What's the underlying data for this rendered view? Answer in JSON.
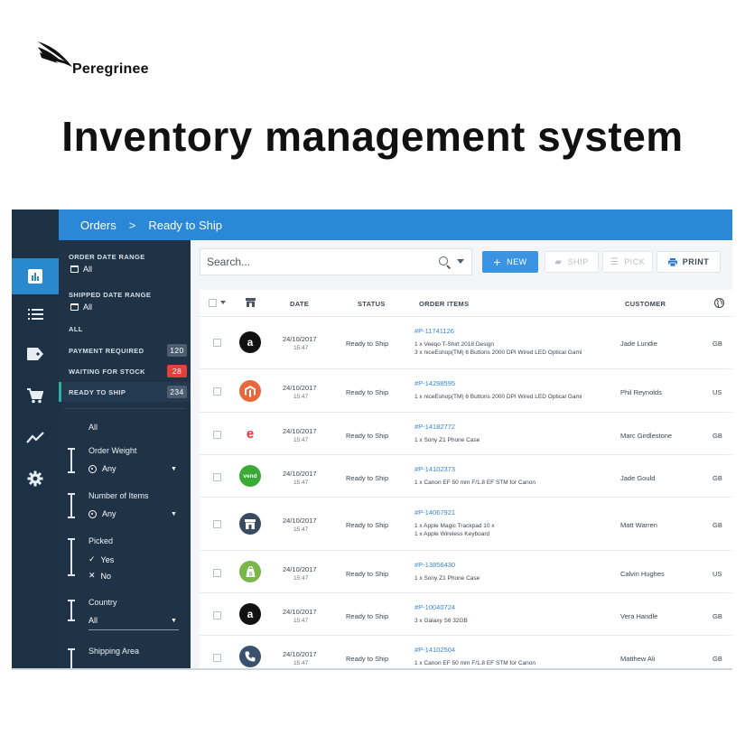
{
  "brand": {
    "name": "Peregrinee",
    "headline": "Inventory management system"
  },
  "colors": {
    "accent": "#2a88d6",
    "sidebar": "#1d3144",
    "filter_panel": "#1f3246",
    "badge_alert": "#e0423a",
    "link": "#3a87d2"
  },
  "nav_rail": {
    "items": [
      {
        "icon": "bar-chart-icon",
        "active": true
      },
      {
        "icon": "list-icon",
        "active": false
      },
      {
        "icon": "tag-icon",
        "active": false
      },
      {
        "icon": "cart-icon",
        "active": false
      },
      {
        "icon": "trend-line-icon",
        "active": false
      },
      {
        "icon": "gear-icon",
        "active": false
      }
    ]
  },
  "breadcrumb": {
    "root": "Orders",
    "separator": ">",
    "current": "Ready to Ship"
  },
  "filters": {
    "order_date_label": "ORDER DATE RANGE",
    "order_date_value": "All",
    "shipped_date_label": "SHIPPED DATE RANGE",
    "shipped_date_value": "All",
    "status_all": "ALL",
    "statuses": [
      {
        "label": "PAYMENT REQUIRED",
        "count": "120",
        "alert": false
      },
      {
        "label": "WAITING FOR STOCK",
        "count": "28",
        "alert": true
      },
      {
        "label": "READY TO SHIP",
        "count": "234",
        "alert": false,
        "selected": true
      }
    ],
    "all_label": "All",
    "order_weight": {
      "title": "Order Weight",
      "value": "Any"
    },
    "number_of_items": {
      "title": "Number of Items",
      "value": "Any"
    },
    "picked": {
      "title": "Picked",
      "yes": "Yes",
      "no": "No"
    },
    "country": {
      "title": "Country",
      "value": "All"
    },
    "shipping_area": {
      "title": "Shipping Area"
    }
  },
  "toolbar": {
    "search_placeholder": "Search...",
    "new_label": "NEW",
    "ship_label": "SHIP",
    "pick_label": "PICK",
    "print_label": "PRINT"
  },
  "table": {
    "headers": {
      "date": "DATE",
      "status": "STATUS",
      "order_items": "ORDER ITEMS",
      "customer": "CUSTOMER"
    },
    "rows": [
      {
        "store": "amazon",
        "store_icon": "amazon-icon",
        "date": "24/10/2017",
        "time": "15:47",
        "status": "Ready to Ship",
        "order_id": "#P-11741126",
        "items": [
          "1 x Veeqo T-Shirt 2018 Design",
          "3 x niceEshop(TM) 6 Buttons 2000 DPI Wired LED Optical Gami"
        ],
        "customer": "Jade Lundie",
        "country": "GB"
      },
      {
        "store": "magento",
        "store_icon": "magento-icon",
        "date": "24/10/2017",
        "time": "15:47",
        "status": "Ready to Ship",
        "order_id": "#P-14298595",
        "items": [
          "1 x niceEshop(TM) 6 Buttons 2000 DPI Wired LED Optical Gami"
        ],
        "customer": "Phil Reynolds",
        "country": "US"
      },
      {
        "store": "ebay",
        "store_icon": "ebay-icon",
        "date": "24/10/2017",
        "time": "15:47",
        "status": "Ready to Ship",
        "order_id": "#P-14182772",
        "items": [
          "1 x Sony Z1 Phone Case"
        ],
        "customer": "Marc Girdlestone",
        "country": "GB"
      },
      {
        "store": "vend",
        "store_icon": "vend-icon",
        "date": "24/10/2017",
        "time": "15:47",
        "status": "Ready to Ship",
        "order_id": "#P-14102373",
        "items": [
          "1 x Canon EF 50 mm F/1.8 EF STM for Canon"
        ],
        "customer": "Jade Gould",
        "country": "GB"
      },
      {
        "store": "shop",
        "store_icon": "storefront-icon",
        "date": "24/10/2017",
        "time": "15:47",
        "status": "Ready to Ship",
        "order_id": "#P-14067921",
        "items": [
          "1 x Apple Magic Trackpad 10 x",
          "1 x Apple Wireless Keyboard"
        ],
        "customer": "Matt Warren",
        "country": "GB"
      },
      {
        "store": "shopify",
        "store_icon": "shopify-icon",
        "date": "24/10/2017",
        "time": "15:47",
        "status": "Ready to Ship",
        "order_id": "#P-13856430",
        "items": [
          "1 x Sony Z1 Phone Case"
        ],
        "customer": "Calvin Hughes",
        "country": "US"
      },
      {
        "store": "amazon",
        "store_icon": "amazon-icon",
        "date": "24/10/2017",
        "time": "15:47",
        "status": "Ready to Ship",
        "order_id": "#P-10040724",
        "items": [
          "3 x Galaxy S6 32GB"
        ],
        "customer": "Vera Handle",
        "country": "GB"
      },
      {
        "store": "phone",
        "store_icon": "phone-icon",
        "date": "24/10/2017",
        "time": "15:47",
        "status": "Ready to Ship",
        "order_id": "#P-14102504",
        "items": [
          "1 x Canon EF 50 mm F/1.8 EF STM for Canon"
        ],
        "customer": "Matthew Ali",
        "country": "GB"
      }
    ]
  }
}
